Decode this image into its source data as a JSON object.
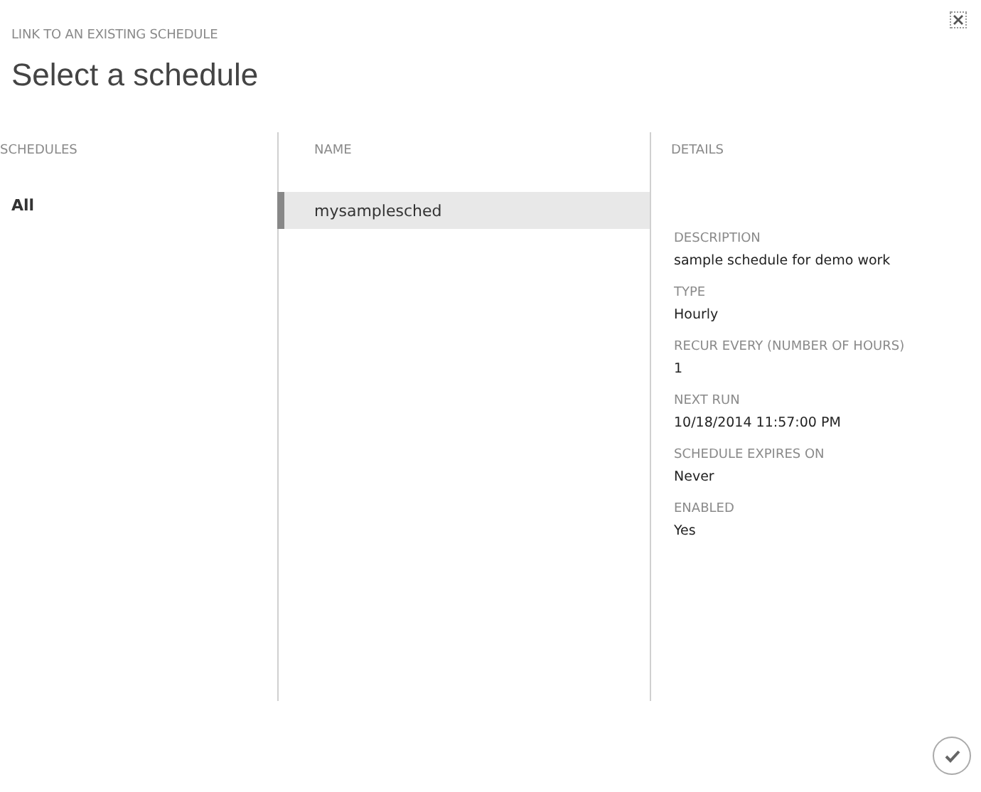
{
  "dialog": {
    "subtitle": "LINK TO AN EXISTING SCHEDULE",
    "title": "Select a schedule"
  },
  "schedules": {
    "heading": "SCHEDULES",
    "items": [
      {
        "label": "All",
        "selected": true
      }
    ]
  },
  "names": {
    "heading": "NAME",
    "items": [
      {
        "label": "mysamplesched",
        "selected": true
      }
    ]
  },
  "details": {
    "heading": "DETAILS",
    "fields": [
      {
        "label": "DESCRIPTION",
        "value": "sample schedule for demo work"
      },
      {
        "label": "TYPE",
        "value": "Hourly"
      },
      {
        "label": "RECUR EVERY (NUMBER OF HOURS)",
        "value": "1"
      },
      {
        "label": "NEXT RUN",
        "value": "10/18/2014 11:57:00 PM"
      },
      {
        "label": "SCHEDULE EXPIRES ON",
        "value": "Never"
      },
      {
        "label": "ENABLED",
        "value": "Yes"
      }
    ]
  }
}
